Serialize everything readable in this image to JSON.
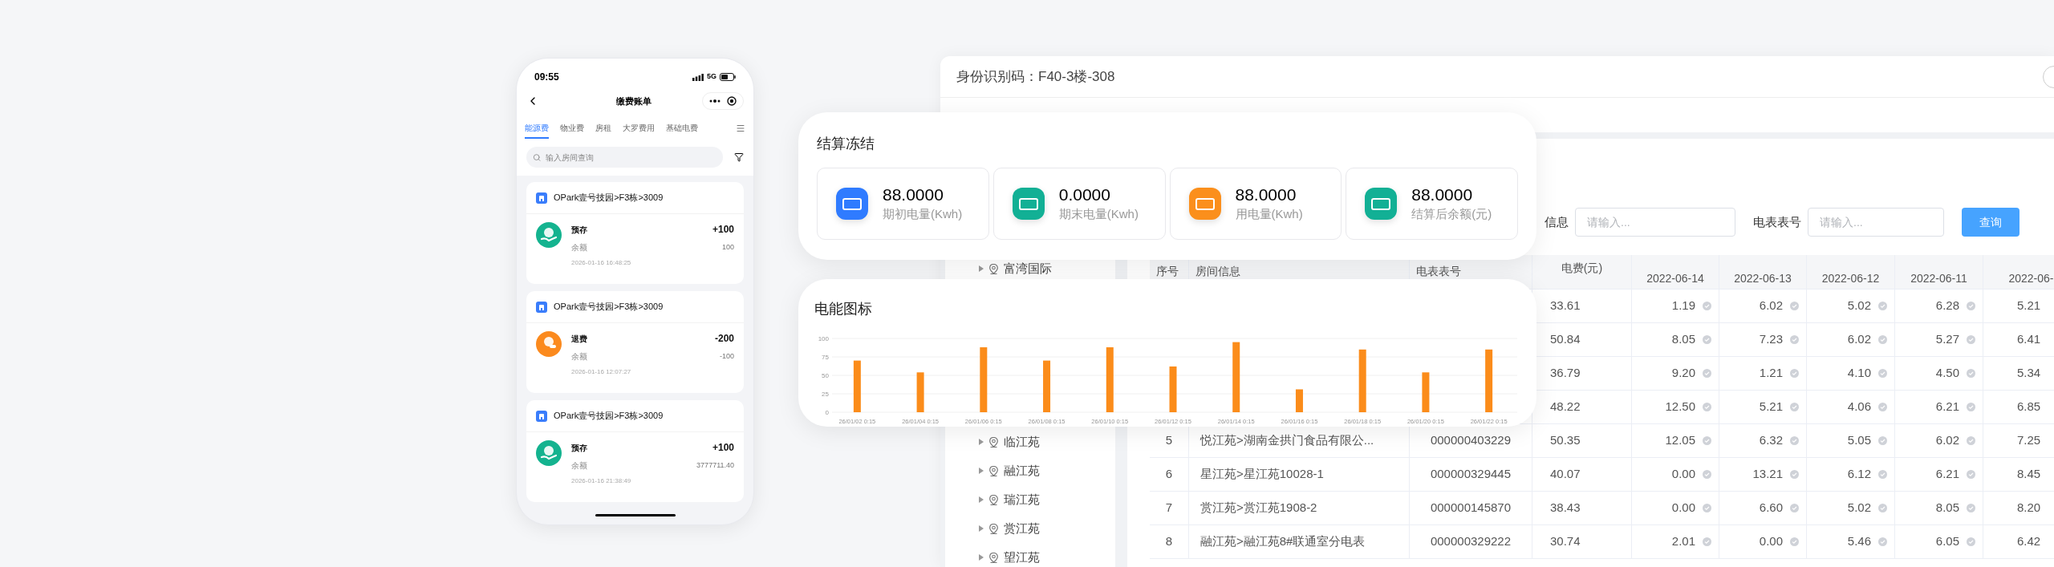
{
  "phone": {
    "time": "09:55",
    "network": "5G",
    "title": "缴费账单",
    "tabs": [
      {
        "label": "能源费",
        "selected": true
      },
      {
        "label": "物业费",
        "selected": false
      },
      {
        "label": "房租",
        "selected": false
      },
      {
        "label": "大罗费用",
        "selected": false
      },
      {
        "label": "基础电费",
        "selected": false
      }
    ],
    "search": {
      "placeholder": "输入房间查询"
    },
    "bills": [
      {
        "room": "OPark壹号技园>F3栋>3009",
        "kind": "deposit",
        "type": "预存",
        "amount": "+100",
        "balance_label": "余额",
        "balance": "100",
        "time": "2026-01-16 16:48:25"
      },
      {
        "room": "OPark壹号技园>F3栋>3009",
        "kind": "refund",
        "type": "退费",
        "amount": "-200",
        "balance_label": "余额",
        "balance": "-100",
        "time": "2026-01-16 12:07:27"
      },
      {
        "room": "OPark壹号技园>F3栋>3009",
        "kind": "deposit",
        "type": "预存",
        "amount": "+100",
        "balance_label": "余额",
        "balance": "3777711.40",
        "time": "2026-01-16 21:38:49"
      }
    ]
  },
  "admin": {
    "id_label": "身份识别码：F40-3楼-308",
    "filters": [
      {
        "label": "信息",
        "placeholder": "请输入..."
      },
      {
        "label": "电表表号",
        "placeholder": "请输入..."
      }
    ],
    "query_button": "查询",
    "tree": [
      {
        "label": "富湾国际",
        "expanded": false
      },
      {
        "label": "临江苑",
        "expanded": false
      },
      {
        "label": "融江苑",
        "expanded": false
      },
      {
        "label": "瑞江苑",
        "expanded": false
      },
      {
        "label": "赏江苑",
        "expanded": false
      },
      {
        "label": "望江苑",
        "expanded": false
      }
    ],
    "table": {
      "columns": [
        "序号",
        "房间信息",
        "电表表号",
        "电费(元)",
        "2022-06-14",
        "2022-06-13",
        "2022-06-12",
        "2022-06-11",
        "2022-06-"
      ],
      "rows": [
        {
          "fee": "33.61",
          "daily": [
            "1.19",
            "6.02",
            "5.02",
            "6.28",
            "5.21"
          ]
        },
        {
          "fee": "50.84",
          "daily": [
            "8.05",
            "7.23",
            "6.02",
            "5.27",
            "6.41"
          ]
        },
        {
          "fee": "36.79",
          "daily": [
            "9.20",
            "1.21",
            "4.10",
            "4.50",
            "5.34"
          ]
        },
        {
          "fee": "48.22",
          "daily": [
            "12.50",
            "5.21",
            "4.06",
            "6.21",
            "6.85"
          ]
        },
        {
          "no": "5",
          "room": "悦江苑>湖南金拱门食品有限公...",
          "meter": "000000403229",
          "fee": "50.35",
          "daily": [
            "12.05",
            "6.32",
            "5.05",
            "6.02",
            "7.25"
          ]
        },
        {
          "no": "6",
          "room": "星江苑>星江苑10028-1",
          "meter": "000000329445",
          "fee": "40.07",
          "daily": [
            "0.00",
            "13.21",
            "6.12",
            "6.21",
            "8.45"
          ]
        },
        {
          "no": "7",
          "room": "赏江苑>赏江苑1908-2",
          "meter": "000000145870",
          "fee": "38.43",
          "daily": [
            "0.00",
            "6.60",
            "5.02",
            "8.05",
            "8.20"
          ]
        },
        {
          "no": "8",
          "room": "融江苑>融江苑8#联通室分电表",
          "meter": "000000329222",
          "fee": "30.74",
          "daily": [
            "2.01",
            "0.00",
            "5.46",
            "6.05",
            "6.42"
          ]
        }
      ]
    }
  },
  "settlement": {
    "title": "结算冻结",
    "stats": [
      {
        "value": "88.0000",
        "label": "期初电量(Kwh)",
        "color": "#2f7bff"
      },
      {
        "value": "0.0000",
        "label": "期末电量(Kwh)",
        "color": "#12b095"
      },
      {
        "value": "88.0000",
        "label": "用电量(Kwh)",
        "color": "#fb8f1c"
      },
      {
        "value": "88.0000",
        "label": "结算后余额(元)",
        "color": "#12b095"
      }
    ]
  },
  "energy": {
    "title": "电能图标",
    "chart_data": {
      "type": "bar",
      "categories": [
        "26/01/02 0:15",
        "26/01/04 0:15",
        "26/01/06 0:15",
        "26/01/08 0:15",
        "26/01/10 0:15",
        "26/01/12 0:15",
        "26/01/14 0:15",
        "26/01/16 0:15",
        "26/01/18 0:15",
        "26/01/20 0:15",
        "26/01/22 0:15"
      ],
      "series": [
        {
          "color": "#fb8c1a",
          "values": [
            70,
            54,
            88,
            70,
            88,
            62,
            95,
            31,
            85,
            54,
            85
          ]
        }
      ],
      "ylim": [
        0,
        100
      ],
      "yticks": [
        0,
        25,
        50,
        75,
        100
      ],
      "grid": true
    }
  }
}
